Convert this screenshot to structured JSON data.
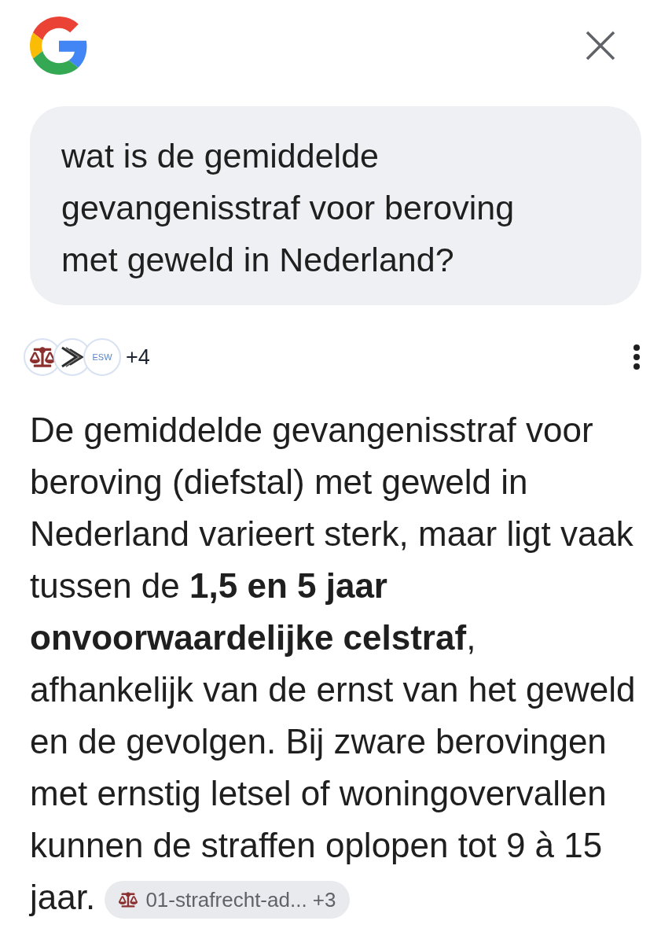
{
  "query": {
    "text": "wat is de gemiddelde gevangenisstraf voor beroving met geweld in Nederland?"
  },
  "sources": {
    "icons": [
      {
        "kind": "scales"
      },
      {
        "kind": "chevrons"
      },
      {
        "kind": "badge",
        "text": "ESW"
      }
    ],
    "more": "+4"
  },
  "answer": {
    "text": "De gemiddelde gevangenisstraf voor beroving (diefstal) met geweld in Nederland varieert sterk, maar ligt vaak tussen de **1,5 en 5 jaar onvoorwaardelijke celstraf**, afhankelijk van de ernst van het geweld en de gevolgen. Bij zware berovingen met ernstig letsel of woningovervallen kunnen de straffen oplopen tot 9 à 15 jaar.",
    "citation": {
      "label": "01-strafrecht-ad...",
      "more": "+3"
    }
  }
}
